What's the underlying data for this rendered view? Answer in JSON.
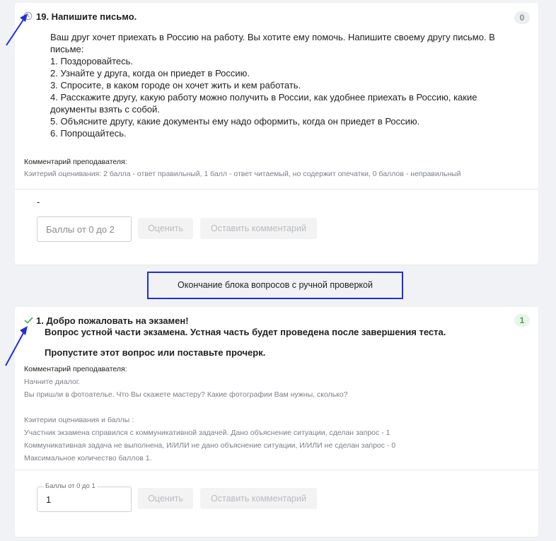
{
  "questions": [
    {
      "title": "19. Напишите письмо.",
      "score": "0",
      "status_icon": "clock-icon",
      "body": [
        "Ваш друг хочет приехать в Россию на работу. Вы хотите ему помочь. Напишите своему другу письмо. В",
        "письме:",
        "1. Поздоровайтесь.",
        "2. Узнайте у друга, когда он приедет в Россию.",
        "3. Спросите, в каком городе он хочет жить и кем работать.",
        "4. Расскажите другу, какую работу можно получить в России, как удобнее приехать в Россию, какие",
        "документы взять с собой.",
        "5. Объясните другу, какие документы ему надо оформить, когда он приедет в Россию.",
        "6. Попрощайтесь."
      ],
      "comment_label": "Комментарий преподавателя:",
      "comment_lines": [
        "Кэитерий оценивания: 2 балла - ответ правильный, 1 балл - ответ читаемый, но содержит опечатки, 0 баллов - неправильный"
      ],
      "answer": "-",
      "score_input_placeholder": "Баллы от 0 до 2",
      "score_input_value": "",
      "rate_button": "Оценить",
      "comment_button": "Оставить комментарий"
    },
    {
      "title": "1. Добро пожаловать на экзамен!",
      "title_lines": [
        "Вопрос устной части экзамена. Устная часть будет проведена после завершения теста.",
        "Пропустите этот вопрос или поставьте прочерк."
      ],
      "score": "1",
      "status_icon": "check-icon",
      "comment_label": "Комментарий преподавателя:",
      "comment_lines": [
        "Начните диалог.",
        "Вы пришли в фотоателье. Что Вы скажете мастеру? Какие фотографии Вам нужны, сколько?",
        "",
        "Кэитерии оценивания и баллы :",
        "Участник экзамена справился с коммуникативной задачей. Дано объяснение ситуации, сделан запрос - 1",
        "Коммуникативная задача не выполнена, И/ИЛИ не дано объяснение ситуации, И/ИЛИ не сделан запрос - 0",
        "Максимальное количество баллов 1."
      ],
      "score_input_label": "Баллы от 0 до 1",
      "score_input_value": "1",
      "rate_button": "Оценить",
      "comment_button": "Оставить комментарий"
    }
  ],
  "section_divider": "Окончание блока вопросов с ручной проверкой",
  "colors": {
    "annotation_blue": "#1f2fd8",
    "check_green": "#3aa757",
    "badge_grey_bg": "#eceef1",
    "badge_green_bg": "#e7f5ea"
  }
}
